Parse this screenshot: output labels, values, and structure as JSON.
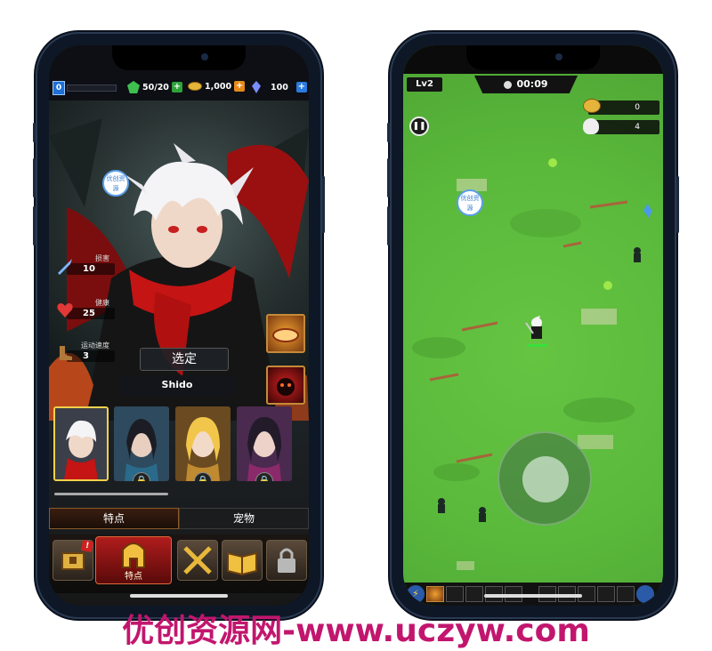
{
  "left_screen": {
    "level": "0",
    "energy": "50/20",
    "gold": "1,000",
    "gems": "100",
    "stats": [
      {
        "label": "损害",
        "value": "10",
        "icon": "sword-icon"
      },
      {
        "label": "健康",
        "value": "25",
        "icon": "heart-icon"
      },
      {
        "label": "运动速度",
        "value": "3",
        "icon": "boot-icon"
      }
    ],
    "select_label": "选定",
    "hero_name": "Shido",
    "tabs": [
      "特点",
      "宠物"
    ],
    "nav_main_label": "特点",
    "alert_badge": "!",
    "watermark_badge": "优创资源"
  },
  "right_screen": {
    "level": "Lv2",
    "timer": "00:09",
    "coins": "0",
    "kills": "4",
    "watermark_badge": "优创资源"
  },
  "watermark_text": "优创资源网-www.uczyw.com",
  "colors": {
    "watermark": "#c2166e",
    "grass": "#5ab93b",
    "accent_red": "#b01c1c",
    "gold": "#f3d24c"
  }
}
